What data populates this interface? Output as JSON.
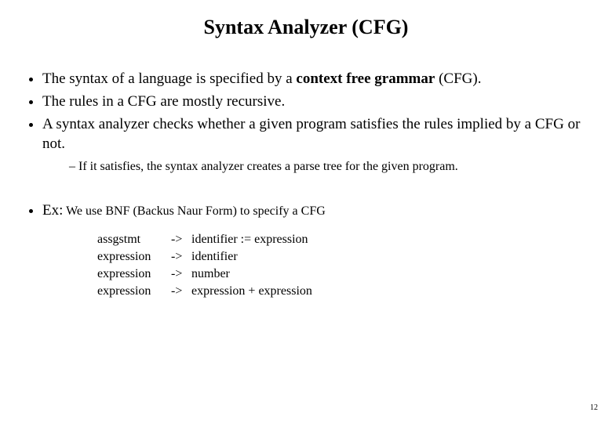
{
  "title": "Syntax Analyzer (CFG)",
  "bullets": {
    "b1_pre": "The syntax of a language is specified by a ",
    "b1_bold": "context free grammar",
    "b1_post": " (CFG).",
    "b2": "The rules in a CFG are mostly recursive.",
    "b3": "A syntax analyzer checks whether a given program satisfies the rules implied by a CFG or not.",
    "b3_sub1": "If it satisfies, the syntax analyzer creates a parse tree for the given program.",
    "b4_label": "Ex:",
    "b4_body": " We use BNF (Backus Naur Form) to specify a CFG"
  },
  "grammar": {
    "rows": [
      {
        "lhs": "assgstmt",
        "arrow": "->",
        "rhs": "identifier := expression"
      },
      {
        "lhs": "expression",
        "arrow": "->",
        "rhs": "identifier"
      },
      {
        "lhs": "expression",
        "arrow": "->",
        "rhs": "number"
      },
      {
        "lhs": "expression",
        "arrow": "->",
        "rhs": "expression + expression"
      }
    ]
  },
  "page_number": "12"
}
